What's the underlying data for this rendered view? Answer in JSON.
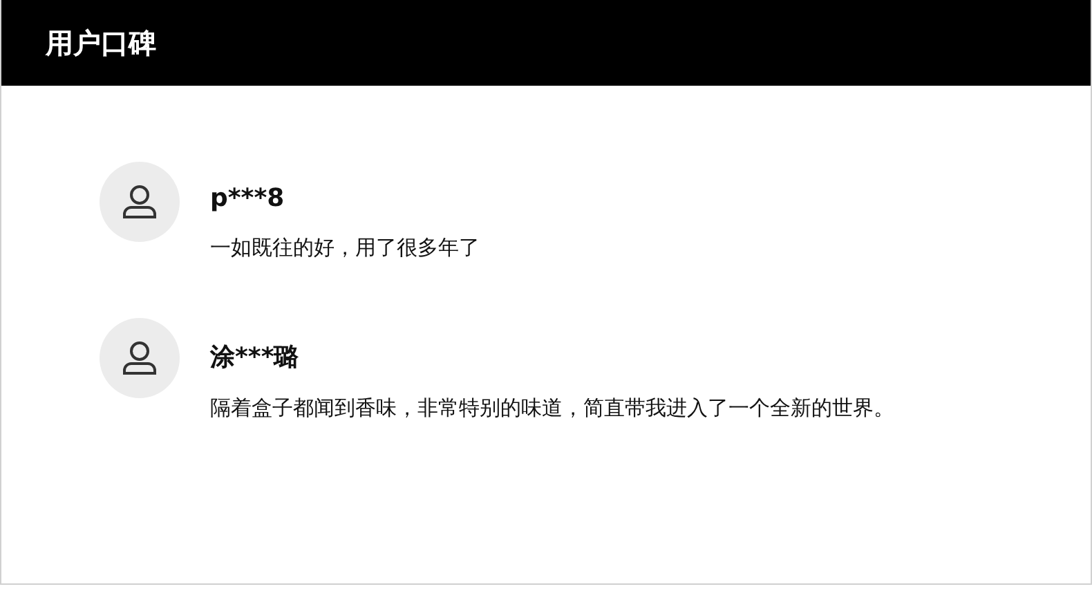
{
  "header": {
    "title": "用户口碑"
  },
  "reviews": [
    {
      "user": "p***8",
      "text": "一如既往的好，用了很多年了"
    },
    {
      "user": "涂***璐",
      "text": "隔着盒子都闻到香味，非常特别的味道，简直带我进入了一个全新的世界。"
    }
  ]
}
